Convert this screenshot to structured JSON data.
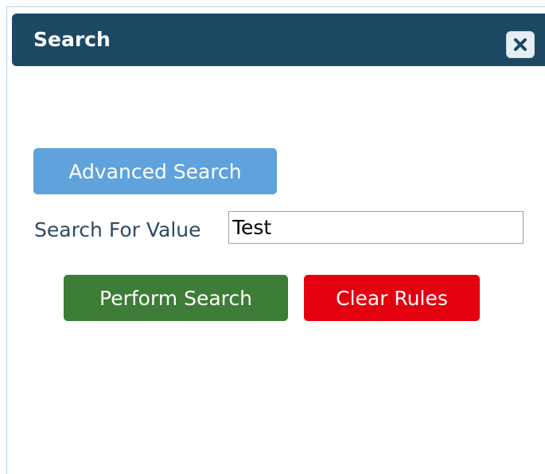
{
  "dialog": {
    "title": "Search",
    "close_icon": "close-x-icon"
  },
  "advanced_search": {
    "label": "Advanced Search"
  },
  "search_field": {
    "label": "Search For Value",
    "value": "Test"
  },
  "actions": {
    "perform_label": "Perform Search",
    "clear_label": "Clear Rules"
  },
  "colors": {
    "titlebar": "#1c4864",
    "advanced_button": "#5fa2dc",
    "perform_button": "#3d7d37",
    "clear_button": "#e3000f",
    "label_text": "#2d4a63"
  }
}
